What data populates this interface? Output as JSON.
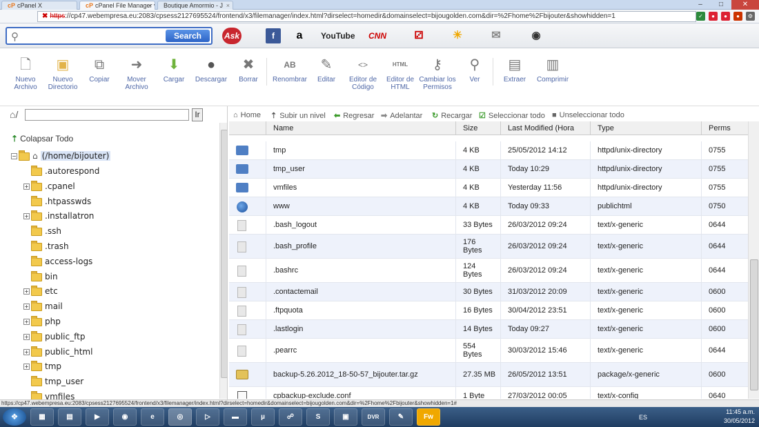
{
  "browser": {
    "tabs": [
      {
        "label": "cPanel X",
        "active": false
      },
      {
        "label": "cPanel File Manager v",
        "active": true
      },
      {
        "label": "Boutique Amormio - J",
        "active": false
      }
    ],
    "url_scheme": "https",
    "url_rest": "://cp47.webempresa.eu:2083/cpsess2127695524/frontend/x3/filemanager/index.html?dirselect=homedir&domainselect=bijougolden.com&dir=%2Fhome%2Fbijouter&showhidden=1"
  },
  "askbar": {
    "search_button": "Search",
    "logo_text": "Ask",
    "shortcuts": [
      "f",
      "a",
      "YouTube",
      "CNN"
    ]
  },
  "toolbar": {
    "items": [
      {
        "label": "Nuevo Archivo",
        "icon": "new-file-icon"
      },
      {
        "label": "Nuevo Directorio",
        "icon": "new-folder-icon"
      },
      {
        "label": "Copiar",
        "icon": "copy-icon"
      },
      {
        "label": "Mover Archivo",
        "icon": "move-icon"
      },
      {
        "label": "Cargar",
        "icon": "upload-icon"
      },
      {
        "label": "Descargar",
        "icon": "download-icon"
      },
      {
        "label": "Borrar",
        "icon": "delete-icon"
      },
      {
        "label": "Renombrar",
        "icon": "rename-icon"
      },
      {
        "label": "Editar",
        "icon": "edit-icon"
      },
      {
        "label": "Editor de Código",
        "icon": "code-editor-icon"
      },
      {
        "label": "Editor de HTML",
        "icon": "html-editor-icon"
      },
      {
        "label": "Cambiar los Permisos",
        "icon": "permissions-icon"
      },
      {
        "label": "Ver",
        "icon": "view-icon"
      },
      {
        "label": "Extraer",
        "icon": "extract-icon"
      },
      {
        "label": "Comprimir",
        "icon": "compress-icon"
      }
    ]
  },
  "left": {
    "path_value": "",
    "go_label": "Ir",
    "collapse_label": "Colapsar Todo",
    "root_label": "(/home/bijouter)",
    "tree": [
      {
        "label": ".autorespond",
        "expandable": false
      },
      {
        "label": ".cpanel",
        "expandable": true
      },
      {
        "label": ".htpasswds",
        "expandable": false
      },
      {
        "label": ".installatron",
        "expandable": true
      },
      {
        "label": ".ssh",
        "expandable": false
      },
      {
        "label": ".trash",
        "expandable": false
      },
      {
        "label": "access-logs",
        "expandable": false
      },
      {
        "label": "bin",
        "expandable": false
      },
      {
        "label": "etc",
        "expandable": true
      },
      {
        "label": "mail",
        "expandable": true
      },
      {
        "label": "php",
        "expandable": true
      },
      {
        "label": "public_ftp",
        "expandable": true
      },
      {
        "label": "public_html",
        "expandable": true
      },
      {
        "label": "tmp",
        "expandable": true
      },
      {
        "label": "tmp_user",
        "expandable": false
      },
      {
        "label": "vmfiles",
        "expandable": false
      }
    ]
  },
  "navbar": {
    "home": "Home",
    "up": "Subir un nivel",
    "back": "Regresar",
    "forward": "Adelantar",
    "reload": "Recargar",
    "select_all": "Seleccionar todo",
    "unselect_all": "Unseleccionar todo"
  },
  "grid": {
    "headers": {
      "name": "Name",
      "size": "Size",
      "modified": "Last Modified (Hora está",
      "type": "Type",
      "perms": "Perms"
    },
    "rows": [
      {
        "icon": "folder",
        "name": "tmp",
        "size": "4 KB",
        "modified": "25/05/2012 14:12",
        "type": "httpd/unix-directory",
        "perms": "0755"
      },
      {
        "icon": "folder",
        "name": "tmp_user",
        "size": "4 KB",
        "modified": "Today 10:29",
        "type": "httpd/unix-directory",
        "perms": "0755"
      },
      {
        "icon": "folder",
        "name": "vmfiles",
        "size": "4 KB",
        "modified": "Yesterday 11:56",
        "type": "httpd/unix-directory",
        "perms": "0755"
      },
      {
        "icon": "web",
        "name": "www",
        "size": "4 KB",
        "modified": "Today 09:33",
        "type": "publichtml",
        "perms": "0750"
      },
      {
        "icon": "file",
        "name": ".bash_logout",
        "size": "33 Bytes",
        "modified": "26/03/2012 09:24",
        "type": "text/x-generic",
        "perms": "0644"
      },
      {
        "icon": "file",
        "name": ".bash_profile",
        "size": "176 Bytes",
        "modified": "26/03/2012 09:24",
        "type": "text/x-generic",
        "perms": "0644"
      },
      {
        "icon": "file",
        "name": ".bashrc",
        "size": "124 Bytes",
        "modified": "26/03/2012 09:24",
        "type": "text/x-generic",
        "perms": "0644"
      },
      {
        "icon": "file",
        "name": ".contactemail",
        "size": "30 Bytes",
        "modified": "31/03/2012 20:09",
        "type": "text/x-generic",
        "perms": "0600"
      },
      {
        "icon": "file",
        "name": ".ftpquota",
        "size": "16 Bytes",
        "modified": "30/04/2012 23:51",
        "type": "text/x-generic",
        "perms": "0600"
      },
      {
        "icon": "file",
        "name": ".lastlogin",
        "size": "14 Bytes",
        "modified": "Today 09:27",
        "type": "text/x-generic",
        "perms": "0600"
      },
      {
        "icon": "file",
        "name": ".pearrc",
        "size": "554 Bytes",
        "modified": "30/03/2012 15:46",
        "type": "text/x-generic",
        "perms": "0644"
      },
      {
        "icon": "pkg",
        "name": "backup-5.26.2012_18-50-57_bijouter.tar.gz",
        "size": "27.35 MB",
        "modified": "26/05/2012 13:51",
        "type": "package/x-generic",
        "perms": "0600"
      },
      {
        "icon": "conf",
        "name": "cpbackup-exclude.conf",
        "size": "1 Byte",
        "modified": "27/03/2012 00:05",
        "type": "text/x-config",
        "perms": "0640"
      }
    ]
  },
  "statusbar": "https://cp47.webempresa.eu:2083/cpsess2127695524/frontend/x3/filemanager/index.html?dirselect=homedir&domainselect=bijougolden.com&dir=%2Fhome%2Fbijouter&showhidden=1#",
  "taskbar": {
    "lang": "ES",
    "time": "11:45 a.m.",
    "date": "30/05/2012",
    "apps": [
      "DVR",
      "Fw"
    ]
  },
  "colors": {
    "accent": "#3e6cc4",
    "row_alt": "#eef2fb",
    "link": "#4d66a6"
  }
}
